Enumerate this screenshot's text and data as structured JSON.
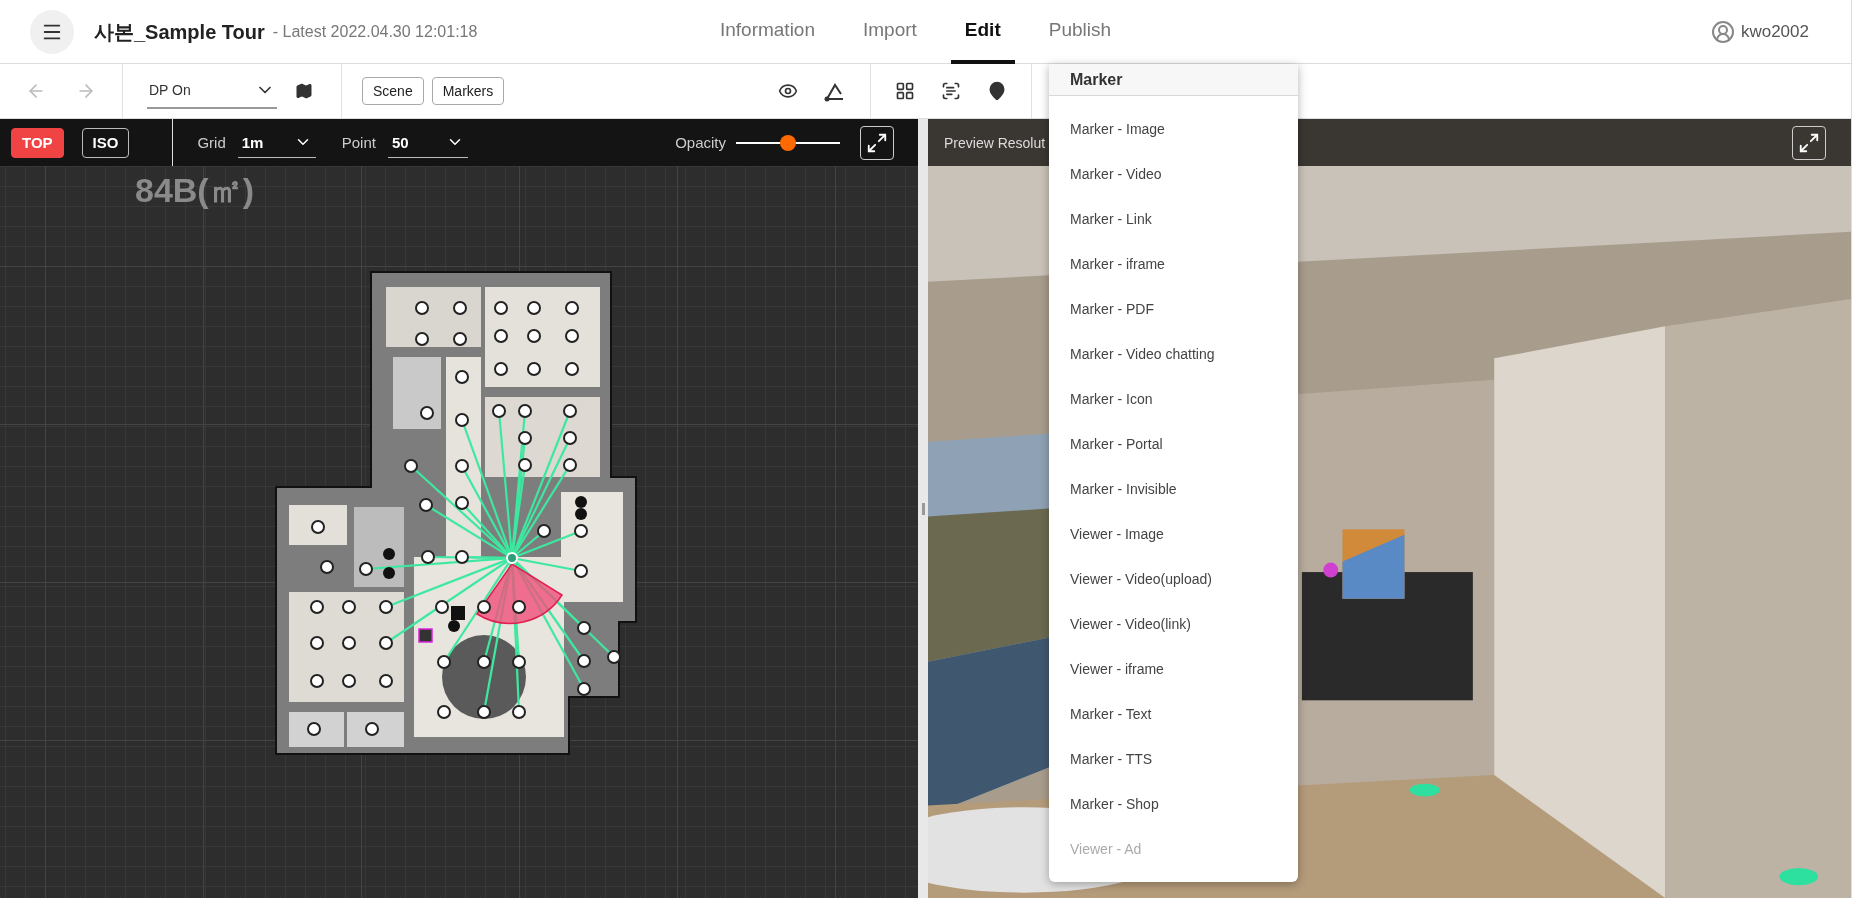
{
  "header": {
    "title": "사본_Sample Tour",
    "subtitle": "- Latest 2022.04.30 12:01:18",
    "user": "kwo2002",
    "tabs": [
      {
        "label": "Information",
        "selected": false
      },
      {
        "label": "Import",
        "selected": false
      },
      {
        "label": "Edit",
        "selected": true
      },
      {
        "label": "Publish",
        "selected": false
      }
    ]
  },
  "toolbar": {
    "dp_select": "DP On",
    "buttons": [
      "Scene",
      "Markers"
    ]
  },
  "view_bar": {
    "modes": [
      {
        "label": "TOP",
        "selected": true
      },
      {
        "label": "ISO",
        "selected": false
      }
    ],
    "grid": {
      "label": "Grid",
      "value": "1m"
    },
    "point": {
      "label": "Point",
      "value": "50"
    },
    "opacity": {
      "label": "Opacity",
      "level": 0.5
    }
  },
  "canvas": {
    "floor_label": "84B(㎡)"
  },
  "preview": {
    "label": "Preview Resolut"
  },
  "marker_menu": {
    "title": "Marker",
    "items": [
      {
        "label": "Marker - Image",
        "disabled": false
      },
      {
        "label": "Marker - Video",
        "disabled": false
      },
      {
        "label": "Marker - Link",
        "disabled": false
      },
      {
        "label": "Marker - iframe",
        "disabled": false
      },
      {
        "label": "Marker - PDF",
        "disabled": false
      },
      {
        "label": "Marker - Video chatting",
        "disabled": false
      },
      {
        "label": "Marker - Icon",
        "disabled": false
      },
      {
        "label": "Marker - Portal",
        "disabled": false
      },
      {
        "label": "Marker - Invisible",
        "disabled": false
      },
      {
        "label": "Viewer - Image",
        "disabled": false
      },
      {
        "label": "Viewer - Video(upload)",
        "disabled": false
      },
      {
        "label": "Viewer - Video(link)",
        "disabled": false
      },
      {
        "label": "Viewer - iframe",
        "disabled": false
      },
      {
        "label": "Marker - Text",
        "disabled": false
      },
      {
        "label": "Marker - TTS",
        "disabled": false
      },
      {
        "label": "Marker - Shop",
        "disabled": false
      },
      {
        "label": "Viewer - Ad",
        "disabled": true
      }
    ]
  }
}
